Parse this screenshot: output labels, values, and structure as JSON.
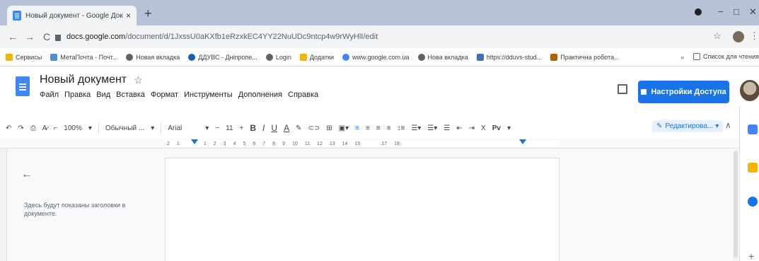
{
  "browser": {
    "tab_title": "Новый документ - Google Доку",
    "tab_close": "×",
    "new_tab": "+",
    "url_host": "docs.google.com",
    "url_path": "/document/d/1JxssU0aKXfb1eRzxkEC4YY22NuUDc9ntcp4w9rWyHlI/edit",
    "controls": {
      "minimize": "−",
      "maximize": "□",
      "close": "✕"
    },
    "nav": {
      "back": "←",
      "forward": "→",
      "reload": "C"
    },
    "star": "☆",
    "menu": "⋮"
  },
  "bookmarks": {
    "items": [
      {
        "label": "Сервисы",
        "color": "#f4b400"
      },
      {
        "label": "МетаПочта - Почт...",
        "color": "#4a8fd8"
      },
      {
        "label": "Новая вкладка",
        "color": "#5f6368"
      },
      {
        "label": "ДДУВС - Дніпропе...",
        "color": "#1a5fb4"
      },
      {
        "label": "Login",
        "color": "#5f6368"
      },
      {
        "label": "Додатки",
        "color": "#f4b400"
      },
      {
        "label": "www.google.com.ua",
        "color": "#4285f4"
      },
      {
        "label": "Нова вкладка",
        "color": "#5f6368"
      },
      {
        "label": "https://dduvs-stud...",
        "color": "#3f6fb5"
      },
      {
        "label": "Практична робота...",
        "color": "#b06000"
      }
    ],
    "more": "»",
    "reading_list": "Список для чтения"
  },
  "docs": {
    "title": "Новый документ",
    "star": "☆",
    "menu": [
      "Файл",
      "Правка",
      "Вид",
      "Вставка",
      "Формат",
      "Инструменты",
      "Дополнения",
      "Справка"
    ],
    "share_label": "Настройки Доступа",
    "toolbar": {
      "zoom": "100%",
      "style": "Обычный ...",
      "font": "Arial",
      "font_size": "11",
      "bold": "B",
      "italic": "I",
      "underline": "U",
      "text_color": "A",
      "clear": "X",
      "input_tools": "Pv"
    },
    "edit_mode": "Редактирова...",
    "ruler": [
      "2",
      "1",
      "1",
      "2",
      "3",
      "4",
      "5",
      "6",
      "7",
      "8",
      "9",
      "10",
      "11",
      "12",
      "13",
      "14",
      "15",
      "17",
      "18"
    ],
    "outline_hint": "Здесь будут показаны заголовки в документе.",
    "accent": "#1a73e8"
  }
}
